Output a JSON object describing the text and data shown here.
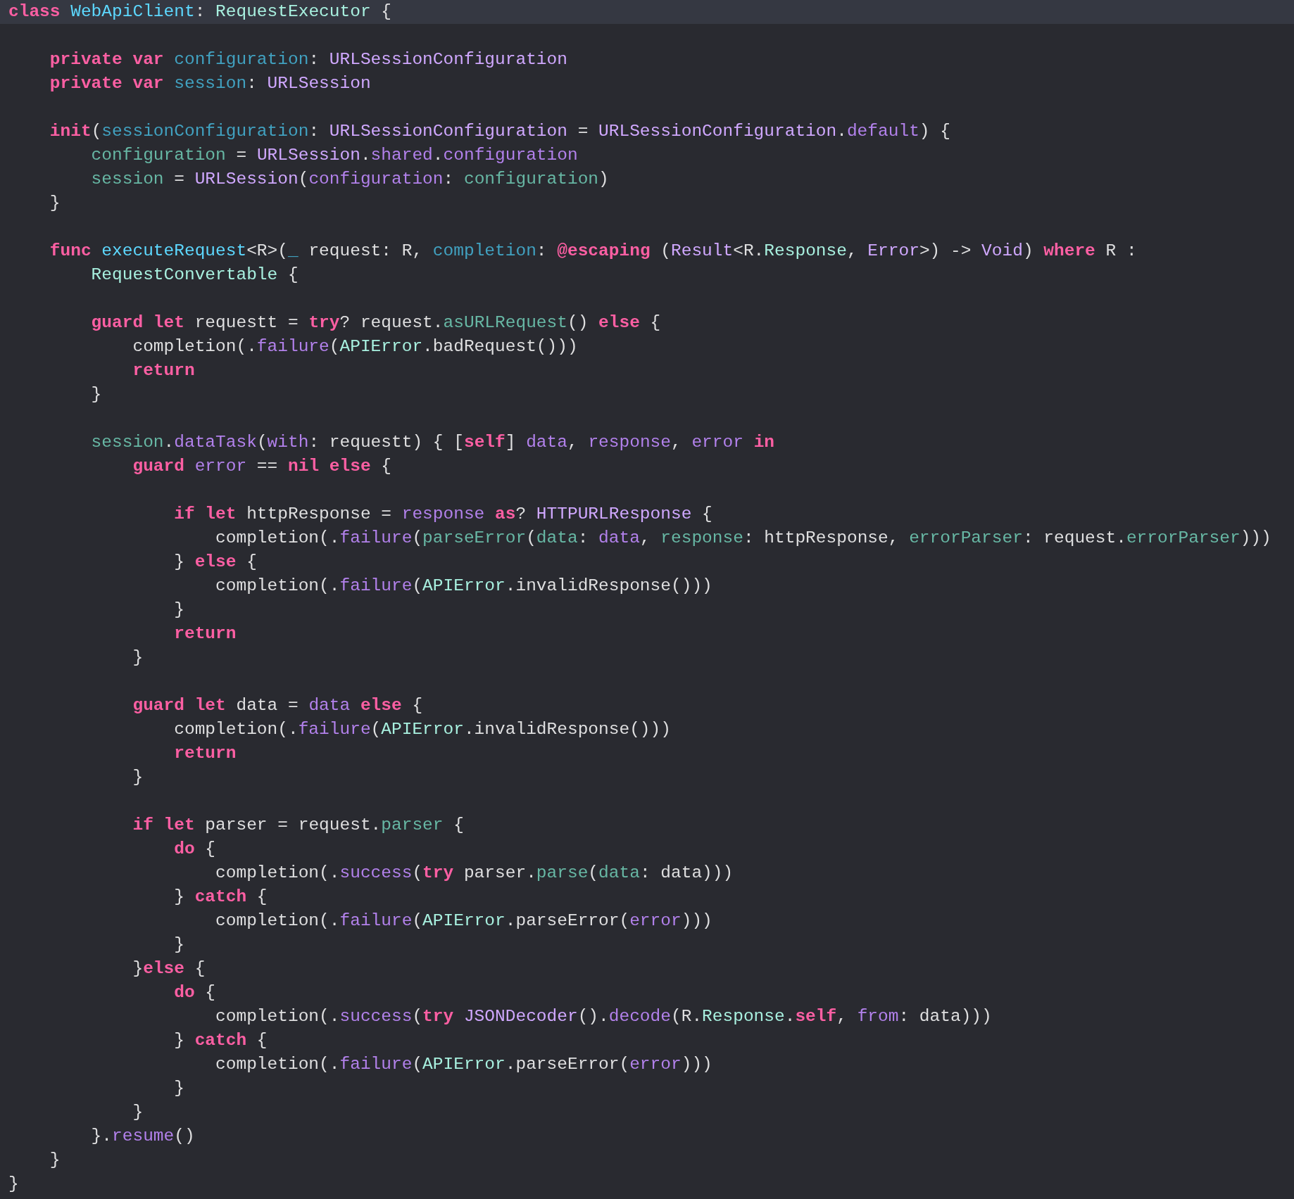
{
  "lines": [
    {
      "highlighted": true,
      "tokens": [
        {
          "kind": "kw",
          "text": "class "
        },
        {
          "kind": "decl",
          "text": "WebApiClient"
        },
        {
          "kind": "plain",
          "text": ": "
        },
        {
          "kind": "type",
          "text": "RequestExecutor"
        },
        {
          "kind": "plain",
          "text": " {"
        }
      ]
    },
    {
      "highlighted": false
    },
    {
      "highlighted": false,
      "tokens": [
        {
          "kind": "kw",
          "text": "    private var "
        },
        {
          "kind": "param",
          "text": "configuration"
        },
        {
          "kind": "plain",
          "text": ": "
        },
        {
          "kind": "systype",
          "text": "URLSessionConfiguration"
        }
      ]
    },
    {
      "highlighted": false,
      "tokens": [
        {
          "kind": "kw",
          "text": "    private var "
        },
        {
          "kind": "param",
          "text": "session"
        },
        {
          "kind": "plain",
          "text": ": "
        },
        {
          "kind": "systype",
          "text": "URLSession"
        }
      ]
    },
    {
      "highlighted": false
    },
    {
      "highlighted": false,
      "tokens": [
        {
          "kind": "kw",
          "text": "    init"
        },
        {
          "kind": "plain",
          "text": "("
        },
        {
          "kind": "param",
          "text": "sessionConfiguration"
        },
        {
          "kind": "plain",
          "text": ": "
        },
        {
          "kind": "systype",
          "text": "URLSessionConfiguration"
        },
        {
          "kind": "plain",
          "text": " = "
        },
        {
          "kind": "systype",
          "text": "URLSessionConfiguration"
        },
        {
          "kind": "plain",
          "text": "."
        },
        {
          "kind": "member",
          "text": "default"
        },
        {
          "kind": "plain",
          "text": ") {"
        }
      ]
    },
    {
      "highlighted": false,
      "tokens": [
        {
          "kind": "proj",
          "text": "        configuration"
        },
        {
          "kind": "plain",
          "text": " = "
        },
        {
          "kind": "systype",
          "text": "URLSession"
        },
        {
          "kind": "plain",
          "text": "."
        },
        {
          "kind": "member",
          "text": "shared"
        },
        {
          "kind": "plain",
          "text": "."
        },
        {
          "kind": "member",
          "text": "configuration"
        }
      ]
    },
    {
      "highlighted": false,
      "tokens": [
        {
          "kind": "proj",
          "text": "        session"
        },
        {
          "kind": "plain",
          "text": " = "
        },
        {
          "kind": "systype",
          "text": "URLSession"
        },
        {
          "kind": "plain",
          "text": "("
        },
        {
          "kind": "member",
          "text": "configuration"
        },
        {
          "kind": "plain",
          "text": ": "
        },
        {
          "kind": "proj",
          "text": "configuration"
        },
        {
          "kind": "plain",
          "text": ")"
        }
      ]
    },
    {
      "highlighted": false,
      "tokens": [
        {
          "kind": "plain",
          "text": "    }"
        }
      ]
    },
    {
      "highlighted": false
    },
    {
      "highlighted": false,
      "tokens": [
        {
          "kind": "kw",
          "text": "    func "
        },
        {
          "kind": "decl",
          "text": "executeRequest"
        },
        {
          "kind": "plain",
          "text": "<R>("
        },
        {
          "kind": "param",
          "text": "_"
        },
        {
          "kind": "plain",
          "text": " request: R, "
        },
        {
          "kind": "param",
          "text": "completion"
        },
        {
          "kind": "plain",
          "text": ": "
        },
        {
          "kind": "kw",
          "text": "@escaping"
        },
        {
          "kind": "plain",
          "text": " ("
        },
        {
          "kind": "systype",
          "text": "Result"
        },
        {
          "kind": "plain",
          "text": "<R."
        },
        {
          "kind": "type",
          "text": "Response"
        },
        {
          "kind": "plain",
          "text": ", "
        },
        {
          "kind": "systype",
          "text": "Error"
        },
        {
          "kind": "plain",
          "text": ">) -> "
        },
        {
          "kind": "systype",
          "text": "Void"
        },
        {
          "kind": "plain",
          "text": ") "
        },
        {
          "kind": "kw",
          "text": "where"
        },
        {
          "kind": "plain",
          "text": " R :"
        }
      ]
    },
    {
      "highlighted": false,
      "tokens": [
        {
          "kind": "type",
          "text": "        RequestConvertable"
        },
        {
          "kind": "plain",
          "text": " {"
        }
      ]
    },
    {
      "highlighted": false
    },
    {
      "highlighted": false,
      "tokens": [
        {
          "kind": "kw",
          "text": "        guard let"
        },
        {
          "kind": "plain",
          "text": " requestt = "
        },
        {
          "kind": "kw",
          "text": "try"
        },
        {
          "kind": "plain",
          "text": "? request."
        },
        {
          "kind": "proj",
          "text": "asURLRequest"
        },
        {
          "kind": "plain",
          "text": "() "
        },
        {
          "kind": "kw",
          "text": "else"
        },
        {
          "kind": "plain",
          "text": " {"
        }
      ]
    },
    {
      "highlighted": false,
      "tokens": [
        {
          "kind": "plain",
          "text": "            completion(."
        },
        {
          "kind": "member",
          "text": "failure"
        },
        {
          "kind": "plain",
          "text": "("
        },
        {
          "kind": "type",
          "text": "APIError"
        },
        {
          "kind": "plain",
          "text": ".badRequest()))"
        }
      ]
    },
    {
      "highlighted": false,
      "tokens": [
        {
          "kind": "kw",
          "text": "            return"
        }
      ]
    },
    {
      "highlighted": false,
      "tokens": [
        {
          "kind": "plain",
          "text": "        }"
        }
      ]
    },
    {
      "highlighted": false
    },
    {
      "highlighted": false,
      "tokens": [
        {
          "kind": "proj",
          "text": "        session"
        },
        {
          "kind": "plain",
          "text": "."
        },
        {
          "kind": "member",
          "text": "dataTask"
        },
        {
          "kind": "plain",
          "text": "("
        },
        {
          "kind": "member",
          "text": "with"
        },
        {
          "kind": "plain",
          "text": ": requestt) { ["
        },
        {
          "kind": "kw",
          "text": "self"
        },
        {
          "kind": "plain",
          "text": "] "
        },
        {
          "kind": "member",
          "text": "data"
        },
        {
          "kind": "plain",
          "text": ", "
        },
        {
          "kind": "member",
          "text": "response"
        },
        {
          "kind": "plain",
          "text": ", "
        },
        {
          "kind": "member",
          "text": "error "
        },
        {
          "kind": "kw",
          "text": "in"
        }
      ]
    },
    {
      "highlighted": false,
      "tokens": [
        {
          "kind": "kw",
          "text": "            guard "
        },
        {
          "kind": "member",
          "text": "error"
        },
        {
          "kind": "plain",
          "text": " == "
        },
        {
          "kind": "kw",
          "text": "nil else"
        },
        {
          "kind": "plain",
          "text": " {"
        }
      ]
    },
    {
      "highlighted": false
    },
    {
      "highlighted": false,
      "tokens": [
        {
          "kind": "kw",
          "text": "                if let"
        },
        {
          "kind": "plain",
          "text": " httpResponse = "
        },
        {
          "kind": "member",
          "text": "response "
        },
        {
          "kind": "kw",
          "text": "as"
        },
        {
          "kind": "plain",
          "text": "? "
        },
        {
          "kind": "systype",
          "text": "HTTPURLResponse"
        },
        {
          "kind": "plain",
          "text": " {"
        }
      ]
    },
    {
      "highlighted": false,
      "tokens": [
        {
          "kind": "plain",
          "text": "                    completion(."
        },
        {
          "kind": "member",
          "text": "failure"
        },
        {
          "kind": "plain",
          "text": "("
        },
        {
          "kind": "proj",
          "text": "parseError"
        },
        {
          "kind": "plain",
          "text": "("
        },
        {
          "kind": "proj",
          "text": "data"
        },
        {
          "kind": "plain",
          "text": ": "
        },
        {
          "kind": "member",
          "text": "data"
        },
        {
          "kind": "plain",
          "text": ", "
        },
        {
          "kind": "proj",
          "text": "response"
        },
        {
          "kind": "plain",
          "text": ": httpResponse, "
        },
        {
          "kind": "proj",
          "text": "errorParser"
        },
        {
          "kind": "plain",
          "text": ": request."
        },
        {
          "kind": "proj",
          "text": "errorParser"
        },
        {
          "kind": "plain",
          "text": ")))"
        }
      ]
    },
    {
      "highlighted": false,
      "tokens": [
        {
          "kind": "plain",
          "text": "                } "
        },
        {
          "kind": "kw",
          "text": "else"
        },
        {
          "kind": "plain",
          "text": " {"
        }
      ]
    },
    {
      "highlighted": false,
      "tokens": [
        {
          "kind": "plain",
          "text": "                    completion(."
        },
        {
          "kind": "member",
          "text": "failure"
        },
        {
          "kind": "plain",
          "text": "("
        },
        {
          "kind": "type",
          "text": "APIError"
        },
        {
          "kind": "plain",
          "text": ".invalidResponse()))"
        }
      ]
    },
    {
      "highlighted": false,
      "tokens": [
        {
          "kind": "plain",
          "text": "                }"
        }
      ]
    },
    {
      "highlighted": false,
      "tokens": [
        {
          "kind": "kw",
          "text": "                return"
        }
      ]
    },
    {
      "highlighted": false,
      "tokens": [
        {
          "kind": "plain",
          "text": "            }"
        }
      ]
    },
    {
      "highlighted": false
    },
    {
      "highlighted": false,
      "tokens": [
        {
          "kind": "kw",
          "text": "            guard let"
        },
        {
          "kind": "plain",
          "text": " data = "
        },
        {
          "kind": "member",
          "text": "data "
        },
        {
          "kind": "kw",
          "text": "else"
        },
        {
          "kind": "plain",
          "text": " {"
        }
      ]
    },
    {
      "highlighted": false,
      "tokens": [
        {
          "kind": "plain",
          "text": "                completion(."
        },
        {
          "kind": "member",
          "text": "failure"
        },
        {
          "kind": "plain",
          "text": "("
        },
        {
          "kind": "type",
          "text": "APIError"
        },
        {
          "kind": "plain",
          "text": ".invalidResponse()))"
        }
      ]
    },
    {
      "highlighted": false,
      "tokens": [
        {
          "kind": "kw",
          "text": "                return"
        }
      ]
    },
    {
      "highlighted": false,
      "tokens": [
        {
          "kind": "plain",
          "text": "            }"
        }
      ]
    },
    {
      "highlighted": false
    },
    {
      "highlighted": false,
      "tokens": [
        {
          "kind": "kw",
          "text": "            if let"
        },
        {
          "kind": "plain",
          "text": " parser = request."
        },
        {
          "kind": "proj",
          "text": "parser"
        },
        {
          "kind": "plain",
          "text": " {"
        }
      ]
    },
    {
      "highlighted": false,
      "tokens": [
        {
          "kind": "kw",
          "text": "                do"
        },
        {
          "kind": "plain",
          "text": " {"
        }
      ]
    },
    {
      "highlighted": false,
      "tokens": [
        {
          "kind": "plain",
          "text": "                    completion(."
        },
        {
          "kind": "member",
          "text": "success"
        },
        {
          "kind": "plain",
          "text": "("
        },
        {
          "kind": "kw",
          "text": "try"
        },
        {
          "kind": "plain",
          "text": " parser."
        },
        {
          "kind": "proj",
          "text": "parse"
        },
        {
          "kind": "plain",
          "text": "("
        },
        {
          "kind": "proj",
          "text": "data"
        },
        {
          "kind": "plain",
          "text": ": data)))"
        }
      ]
    },
    {
      "highlighted": false,
      "tokens": [
        {
          "kind": "plain",
          "text": "                } "
        },
        {
          "kind": "kw",
          "text": "catch"
        },
        {
          "kind": "plain",
          "text": " {"
        }
      ]
    },
    {
      "highlighted": false,
      "tokens": [
        {
          "kind": "plain",
          "text": "                    completion(."
        },
        {
          "kind": "member",
          "text": "failure"
        },
        {
          "kind": "plain",
          "text": "("
        },
        {
          "kind": "type",
          "text": "APIError"
        },
        {
          "kind": "plain",
          "text": ".parseError("
        },
        {
          "kind": "member",
          "text": "error"
        },
        {
          "kind": "plain",
          "text": ")))"
        }
      ]
    },
    {
      "highlighted": false,
      "tokens": [
        {
          "kind": "plain",
          "text": "                }"
        }
      ]
    },
    {
      "highlighted": false,
      "tokens": [
        {
          "kind": "plain",
          "text": "            }"
        },
        {
          "kind": "kw",
          "text": "else"
        },
        {
          "kind": "plain",
          "text": " {"
        }
      ]
    },
    {
      "highlighted": false,
      "tokens": [
        {
          "kind": "kw",
          "text": "                do"
        },
        {
          "kind": "plain",
          "text": " {"
        }
      ]
    },
    {
      "highlighted": false,
      "tokens": [
        {
          "kind": "plain",
          "text": "                    completion(."
        },
        {
          "kind": "member",
          "text": "success"
        },
        {
          "kind": "plain",
          "text": "("
        },
        {
          "kind": "kw",
          "text": "try "
        },
        {
          "kind": "systype",
          "text": "JSONDecoder"
        },
        {
          "kind": "plain",
          "text": "()."
        },
        {
          "kind": "member",
          "text": "decode"
        },
        {
          "kind": "plain",
          "text": "(R."
        },
        {
          "kind": "type",
          "text": "Response"
        },
        {
          "kind": "plain",
          "text": "."
        },
        {
          "kind": "kw",
          "text": "self"
        },
        {
          "kind": "plain",
          "text": ", "
        },
        {
          "kind": "member",
          "text": "from"
        },
        {
          "kind": "plain",
          "text": ": data)))"
        }
      ]
    },
    {
      "highlighted": false,
      "tokens": [
        {
          "kind": "plain",
          "text": "                } "
        },
        {
          "kind": "kw",
          "text": "catch"
        },
        {
          "kind": "plain",
          "text": " {"
        }
      ]
    },
    {
      "highlighted": false,
      "tokens": [
        {
          "kind": "plain",
          "text": "                    completion(."
        },
        {
          "kind": "member",
          "text": "failure"
        },
        {
          "kind": "plain",
          "text": "("
        },
        {
          "kind": "type",
          "text": "APIError"
        },
        {
          "kind": "plain",
          "text": ".parseError("
        },
        {
          "kind": "member",
          "text": "error"
        },
        {
          "kind": "plain",
          "text": ")))"
        }
      ]
    },
    {
      "highlighted": false,
      "tokens": [
        {
          "kind": "plain",
          "text": "                }"
        }
      ]
    },
    {
      "highlighted": false,
      "tokens": [
        {
          "kind": "plain",
          "text": "            }"
        }
      ]
    },
    {
      "highlighted": false,
      "tokens": [
        {
          "kind": "plain",
          "text": "        }."
        },
        {
          "kind": "member",
          "text": "resume"
        },
        {
          "kind": "plain",
          "text": "()"
        }
      ]
    },
    {
      "highlighted": false,
      "tokens": [
        {
          "kind": "plain",
          "text": "    }"
        }
      ]
    },
    {
      "highlighted": false,
      "tokens": [
        {
          "kind": "plain",
          "text": "}"
        }
      ]
    }
  ]
}
